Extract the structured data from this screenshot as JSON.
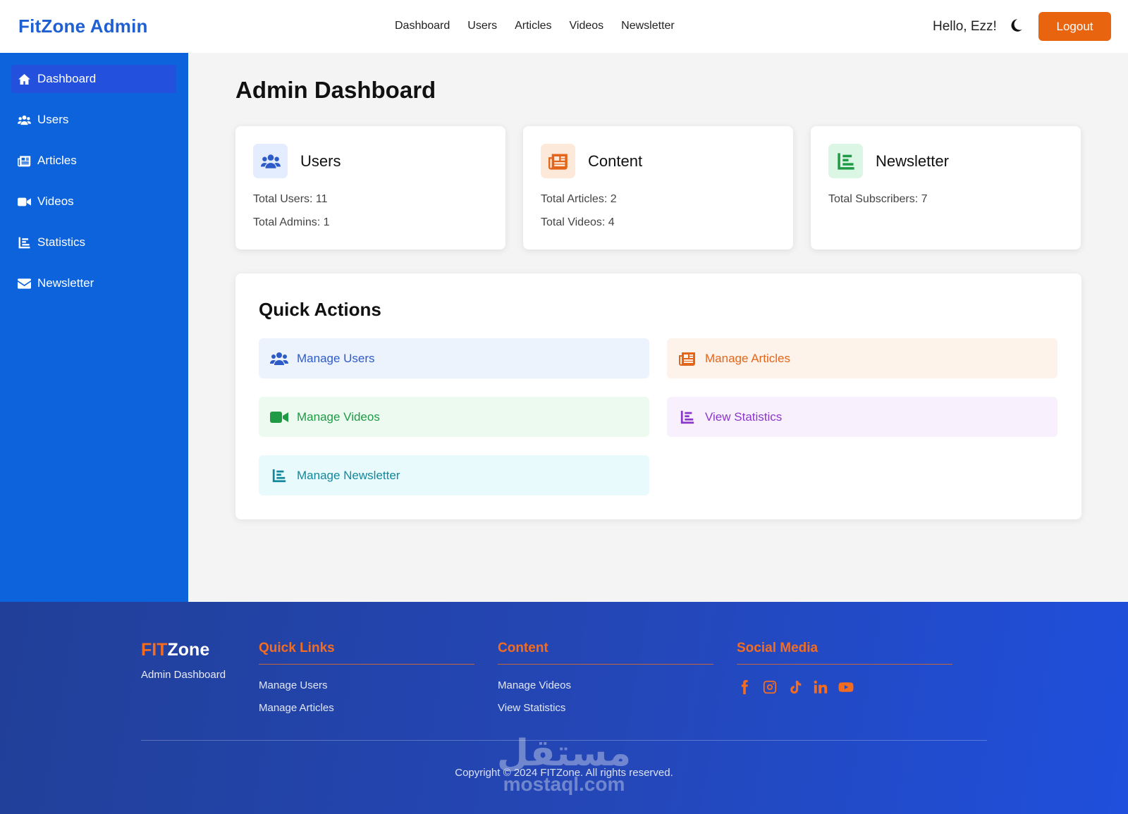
{
  "header": {
    "brand": "FitZone Admin",
    "nav": [
      "Dashboard",
      "Users",
      "Articles",
      "Videos",
      "Newsletter"
    ],
    "greeting": "Hello, Ezz!",
    "logout_label": "Logout"
  },
  "sidebar": {
    "items": [
      {
        "label": "Dashboard",
        "icon": "home-icon",
        "active": true
      },
      {
        "label": "Users",
        "icon": "users-icon"
      },
      {
        "label": "Articles",
        "icon": "newspaper-icon"
      },
      {
        "label": "Videos",
        "icon": "video-icon"
      },
      {
        "label": "Statistics",
        "icon": "chart-icon"
      },
      {
        "label": "Newsletter",
        "icon": "envelope-icon"
      }
    ]
  },
  "main": {
    "title": "Admin Dashboard",
    "cards": [
      {
        "title": "Users",
        "icon": "users-icon",
        "stats": [
          "Total Users: 11",
          "Total Admins: 1"
        ]
      },
      {
        "title": "Content",
        "icon": "newspaper-icon",
        "stats": [
          "Total Articles: 2",
          "Total Videos: 4"
        ]
      },
      {
        "title": "Newsletter",
        "icon": "chart-icon",
        "stats": [
          "Total Subscribers: 7"
        ]
      }
    ],
    "quick_actions": {
      "title": "Quick Actions",
      "items": [
        {
          "label": "Manage Users",
          "icon": "users-icon",
          "color": "#2d5bc8",
          "bg": "#edf3fd"
        },
        {
          "label": "Manage Articles",
          "icon": "newspaper-icon",
          "color": "#e4651a",
          "bg": "#fdf3ea"
        },
        {
          "label": "Manage Videos",
          "icon": "video-icon",
          "color": "#1f9a45",
          "bg": "#ecfaf0"
        },
        {
          "label": "View Statistics",
          "icon": "chart-icon",
          "color": "#8a37c9",
          "bg": "#f8f1fd"
        },
        {
          "label": "Manage Newsletter",
          "icon": "chart-icon",
          "color": "#11889c",
          "bg": "#e9fafc"
        }
      ]
    }
  },
  "footer": {
    "brand_accent": "FIT",
    "brand_rest": "Zone",
    "subtitle": "Admin Dashboard",
    "columns": [
      {
        "title": "Quick Links",
        "links": [
          "Manage Users",
          "Manage Articles"
        ]
      },
      {
        "title": "Content",
        "links": [
          "Manage Videos",
          "View Statistics"
        ]
      },
      {
        "title": "Social Media",
        "icons": [
          "facebook-icon",
          "instagram-icon",
          "tiktok-icon",
          "linkedin-icon",
          "youtube-icon"
        ]
      }
    ],
    "copyright": "Copyright © 2024 FITZone. All rights reserved.",
    "watermark_ar": "مستقل",
    "watermark_en": "mostaql.com"
  },
  "colors": {
    "brand": "#1f5fd1",
    "sidebar": "#0d63dc",
    "sidebar_active": "#2350dd",
    "accent": "#e8640f"
  }
}
